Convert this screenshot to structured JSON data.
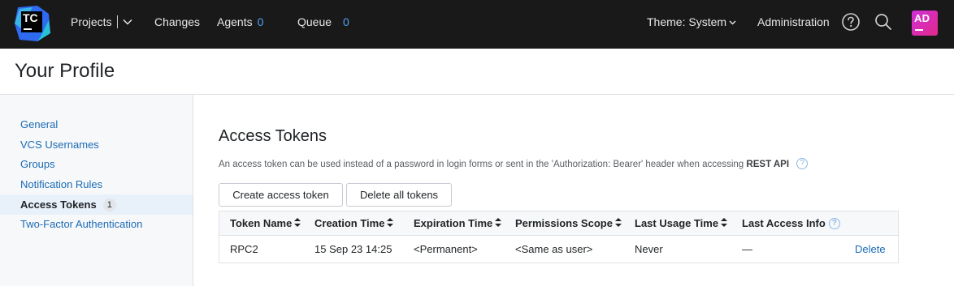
{
  "topbar": {
    "logo_text": "TC",
    "projects_label": "Projects",
    "changes_label": "Changes",
    "agents_label": "Agents",
    "agents_count": "0",
    "queue_label": "Queue",
    "queue_count": "0",
    "theme_label": "Theme: System",
    "administration_label": "Administration",
    "avatar_initials": "AD",
    "icons": [
      "help-icon",
      "search-icon"
    ]
  },
  "header": {
    "title": "Your Profile"
  },
  "sidebar": {
    "items": [
      {
        "label": "General"
      },
      {
        "label": "VCS Usernames"
      },
      {
        "label": "Groups"
      },
      {
        "label": "Notification Rules"
      },
      {
        "label": "Access Tokens",
        "badge": "1",
        "active": true
      },
      {
        "label": "Two-Factor Authentication"
      }
    ]
  },
  "main": {
    "title": "Access Tokens",
    "description": "An access token can be used instead of a password in login forms or sent in the 'Authorization: Bearer' header when accessing",
    "description_strong": "REST API",
    "help_glyph": "?",
    "create_button": "Create access token",
    "delete_all_button": "Delete all tokens",
    "table": {
      "columns": [
        "Token Name",
        "Creation Time",
        "Expiration Time",
        "Permissions Scope",
        "Last Usage Time",
        "Last Access Info"
      ],
      "rows": [
        [
          "RPC2",
          "15 Sep 23 14:25",
          "<Permanent>",
          "<Same as user>",
          "Never",
          "—"
        ]
      ],
      "row_action": "Delete"
    }
  },
  "colors": {
    "topbar_bg": "#19191a",
    "link": "#1a6bb5",
    "count": "#4ea4f5",
    "avatar": "#d12fd8"
  }
}
